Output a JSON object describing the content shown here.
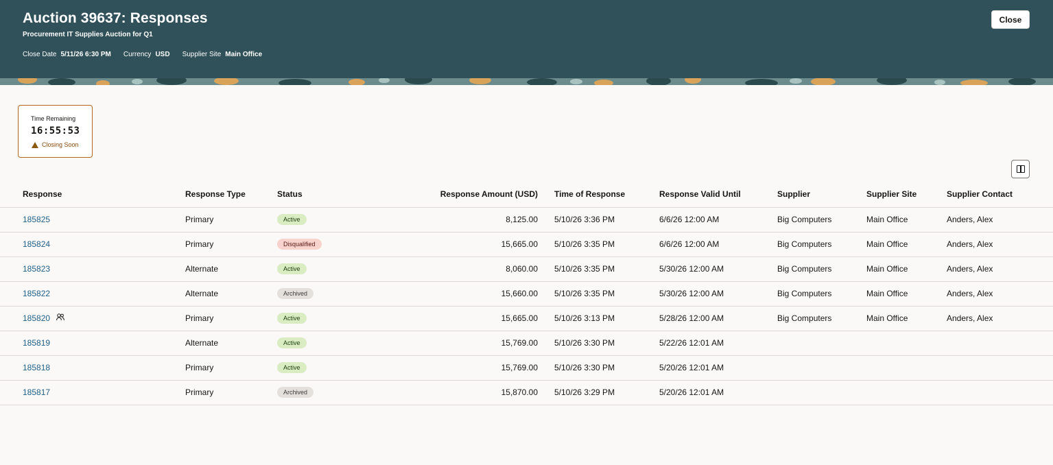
{
  "header": {
    "title": "Auction 39637: Responses",
    "subtitle": "Procurement IT Supplies Auction for Q1",
    "close_date_label": "Close Date",
    "close_date_value": "5/11/26 6:30 PM",
    "currency_label": "Currency",
    "currency_value": "USD",
    "supplier_site_label": "Supplier Site",
    "supplier_site_value": "Main Office",
    "close_button": "Close",
    "background_color": "#30515a"
  },
  "timer": {
    "label": "Time Remaining",
    "value": "16:55:53",
    "status": "Closing Soon",
    "status_icon": "warning-icon",
    "border_color": "#b2681c"
  },
  "toolbar": {
    "column_icon": "columns-icon"
  },
  "table": {
    "columns": {
      "response": "Response",
      "response_type": "Response Type",
      "status": "Status",
      "amount": "Response Amount (USD)",
      "time": "Time of Response",
      "valid_until": "Response Valid Until",
      "supplier": "Supplier",
      "supplier_site": "Supplier Site",
      "supplier_contact": "Supplier Contact"
    },
    "rows": [
      {
        "response": "185825",
        "type": "Primary",
        "status": "Active",
        "status_kind": "active",
        "amount": "8,125.00",
        "time": "5/10/26 3:36 PM",
        "valid": "6/6/26 12:00 AM",
        "supplier": "Big Computers",
        "site": "Main Office",
        "contact": "Anders, Alex",
        "has_people_icon": false
      },
      {
        "response": "185824",
        "type": "Primary",
        "status": "Disqualified",
        "status_kind": "disq",
        "amount": "15,665.00",
        "time": "5/10/26 3:35 PM",
        "valid": "6/6/26 12:00 AM",
        "supplier": "Big Computers",
        "site": "Main Office",
        "contact": "Anders, Alex",
        "has_people_icon": false
      },
      {
        "response": "185823",
        "type": "Alternate",
        "status": "Active",
        "status_kind": "active",
        "amount": "8,060.00",
        "time": "5/10/26 3:35 PM",
        "valid": "5/30/26 12:00 AM",
        "supplier": "Big Computers",
        "site": "Main Office",
        "contact": "Anders, Alex",
        "has_people_icon": false
      },
      {
        "response": "185822",
        "type": "Alternate",
        "status": "Archived",
        "status_kind": "arch",
        "amount": "15,660.00",
        "time": "5/10/26 3:35 PM",
        "valid": "5/30/26 12:00 AM",
        "supplier": "Big Computers",
        "site": "Main Office",
        "contact": "Anders, Alex",
        "has_people_icon": false
      },
      {
        "response": "185820",
        "type": "Primary",
        "status": "Active",
        "status_kind": "active",
        "amount": "15,665.00",
        "time": "5/10/26 3:13 PM",
        "valid": "5/28/26 12:00 AM",
        "supplier": "Big Computers",
        "site": "Main Office",
        "contact": "Anders, Alex",
        "has_people_icon": true
      },
      {
        "response": "185819",
        "type": "Alternate",
        "status": "Active",
        "status_kind": "active",
        "amount": "15,769.00",
        "time": "5/10/26 3:30 PM",
        "valid": "5/22/26 12:01 AM",
        "supplier": "",
        "site": "",
        "contact": "",
        "has_people_icon": false
      },
      {
        "response": "185818",
        "type": "Primary",
        "status": "Active",
        "status_kind": "active",
        "amount": "15,769.00",
        "time": "5/10/26 3:30 PM",
        "valid": "5/20/26 12:01 AM",
        "supplier": "",
        "site": "",
        "contact": "",
        "has_people_icon": false
      },
      {
        "response": "185817",
        "type": "Primary",
        "status": "Archived",
        "status_kind": "arch",
        "amount": "15,870.00",
        "time": "5/10/26 3:29 PM",
        "valid": "5/20/26 12:01 AM",
        "supplier": "",
        "site": "",
        "contact": "",
        "has_people_icon": false
      }
    ]
  },
  "colors": {
    "link": "#216087",
    "active_badge": "#d9ecc2",
    "disqualified_badge": "#f8d3cd",
    "archived_badge": "#e4e1dd"
  }
}
